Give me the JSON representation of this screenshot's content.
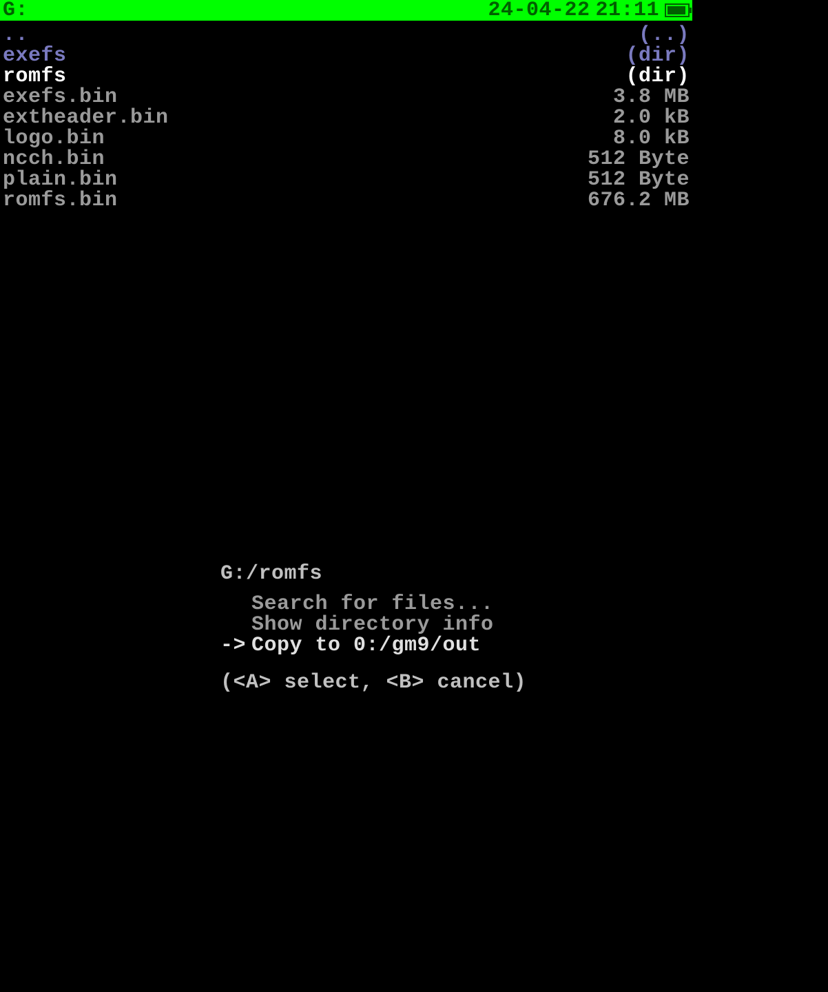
{
  "status": {
    "drive_label": "G:",
    "date": "24-04-22",
    "time": "21:11"
  },
  "files": [
    {
      "name": "..",
      "size": "(..)",
      "kind": "parent"
    },
    {
      "name": "exefs",
      "size": "(dir)",
      "kind": "dir"
    },
    {
      "name": "romfs",
      "size": "(dir)",
      "kind": "selected"
    },
    {
      "name": "exefs.bin",
      "size": "3.8 MB",
      "kind": "file"
    },
    {
      "name": "extheader.bin",
      "size": "2.0 kB",
      "kind": "file"
    },
    {
      "name": "logo.bin",
      "size": "8.0 kB",
      "kind": "file"
    },
    {
      "name": "ncch.bin",
      "size": "512 Byte",
      "kind": "file"
    },
    {
      "name": "plain.bin",
      "size": "512 Byte",
      "kind": "file"
    },
    {
      "name": "romfs.bin",
      "size": "676.2 MB",
      "kind": "file"
    }
  ],
  "menu": {
    "path": "G:/romfs",
    "items": [
      {
        "label": "Search for files...",
        "selected": false
      },
      {
        "label": "Show directory info",
        "selected": false
      },
      {
        "label": "Copy to 0:/gm9/out",
        "selected": true
      }
    ],
    "arrow": "->",
    "hint": "(<A> select, <B> cancel)"
  }
}
